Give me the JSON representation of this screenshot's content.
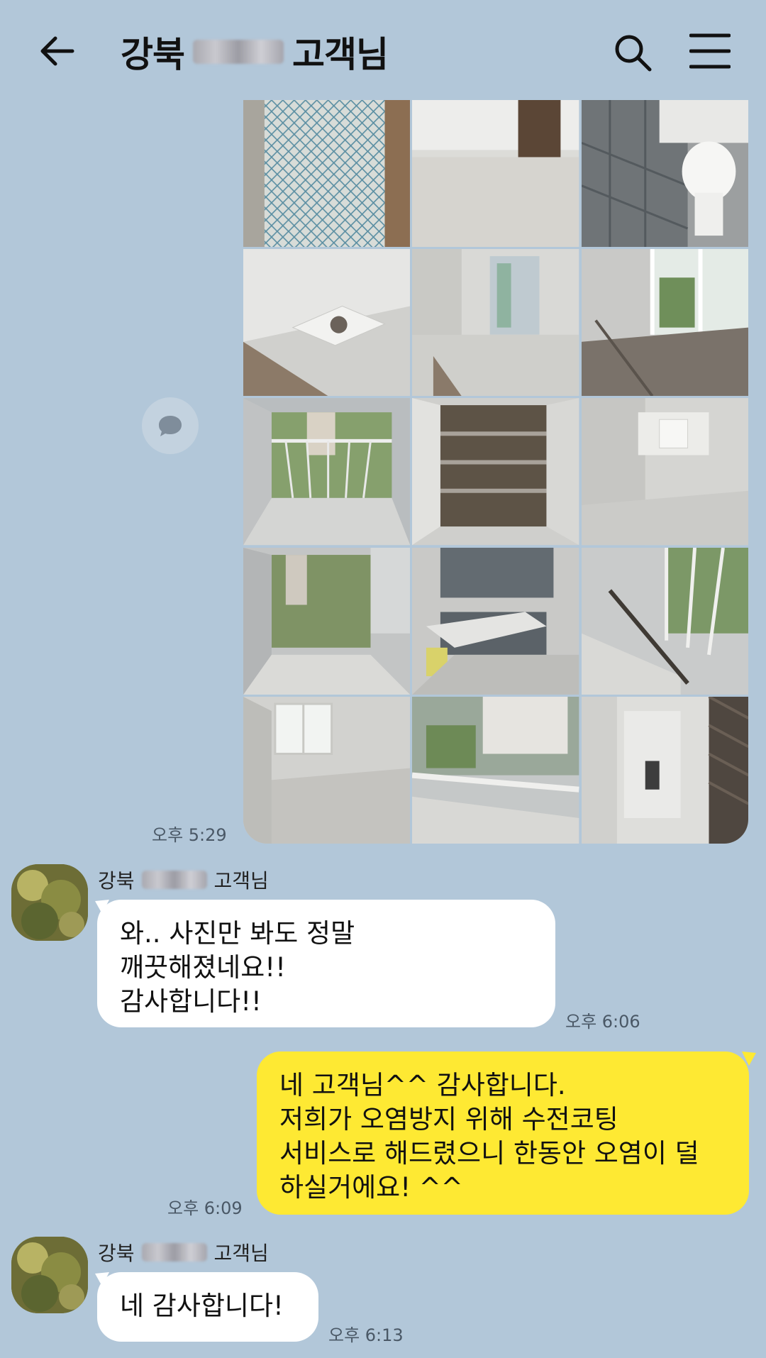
{
  "header": {
    "title_prefix": "강북",
    "title_suffix": "고객님",
    "back_icon": "arrow-left-icon",
    "search_icon": "search-icon",
    "menu_icon": "hamburger-menu-icon"
  },
  "photos": [
    {
      "name": "photo-tiled-floor"
    },
    {
      "name": "photo-room-floor"
    },
    {
      "name": "photo-bathroom-toilet"
    },
    {
      "name": "photo-ceiling-vent"
    },
    {
      "name": "photo-room-balcony-door"
    },
    {
      "name": "photo-room-window-corner"
    },
    {
      "name": "photo-balcony-view"
    },
    {
      "name": "photo-shoe-cabinet"
    },
    {
      "name": "photo-empty-room-window"
    },
    {
      "name": "photo-balcony-trees"
    },
    {
      "name": "photo-kitchen"
    },
    {
      "name": "photo-balcony-railing"
    },
    {
      "name": "photo-room-window"
    },
    {
      "name": "photo-balcony-apartments"
    },
    {
      "name": "photo-hallway"
    }
  ],
  "messages": [
    {
      "time": "오후 5:29"
    },
    {
      "sender_prefix": "강북",
      "sender_suffix": "고객님",
      "lines": [
        "와.. 사진만 봐도 정말",
        "깨끗해졌네요!!",
        "감사합니다!!"
      ],
      "time": "오후 6:06"
    },
    {
      "lines": [
        "네 고객님^^ 감사합니다.",
        "저희가 오염방지 위해 수전코팅",
        "서비스로 해드렸으니 한동안 오염이 덜",
        "하실거에요! ^^"
      ],
      "time": "오후 6:09"
    },
    {
      "sender_prefix": "강북",
      "sender_suffix": "고객님",
      "lines": [
        "네 감사합니다!"
      ],
      "time": "오후 6:13"
    }
  ],
  "colors": {
    "background": "#b2c7d9",
    "my_bubble": "#fee933",
    "other_bubble": "#ffffff"
  }
}
